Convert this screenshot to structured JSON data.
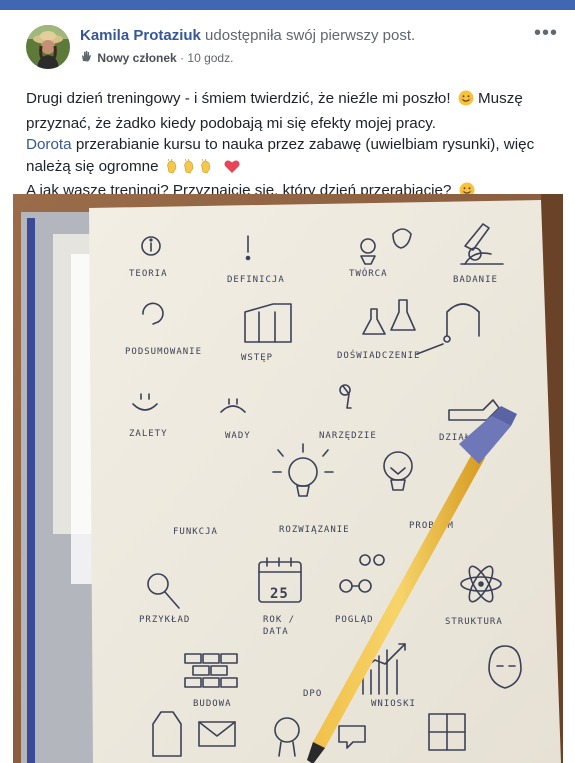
{
  "post": {
    "author_name": "Kamila Protaziuk",
    "action_text": "udostępniła swój pierwszy post.",
    "badge": "Nowy członek",
    "separator": "·",
    "time": "10 godz.",
    "more_label": "•••",
    "lines": {
      "line1": "Drugi dzień treningowy - i śmiem twierdzić, że nieźle mi poszło!",
      "line1b": "Muszę",
      "line2": "przyznać, że żadko kiedy podobają mi się efekty mojej pracy.",
      "mention": "Dorota",
      "line3_rest": "przerabianie kursu to nauka przez zabawę (uwielbiam rysunki), więc",
      "line4": "należą się ogromne",
      "line5": "A jak wasze treningi? Przyznajcie się, który dzień przerabiacie?"
    }
  },
  "sketch_labels": {
    "teoria": "TEORIA",
    "definicja": "DEFINICJA",
    "tworca": "TWÓRCA",
    "badanie": "BADANIE",
    "podsumowanie": "PODSUMOWANIE",
    "wstep": "WSTĘP",
    "doswiadczenie": "DOŚWIADCZENIE",
    "zalety": "ZALETY",
    "wady": "WADY",
    "narzedzie": "NARZĘDZIE",
    "dzialanie": "DZIAŁANIE",
    "funkcja": "FUNKCJA",
    "rozwiazanie": "ROZWIĄZANIE",
    "problem": "PROBLEM",
    "przyklad": "PRZYKŁAD",
    "calendar_num": "25",
    "rok": "ROK /",
    "data": "DATA",
    "poglad": "POGLĄD",
    "struktura": "STRUKTURA",
    "budowa": "BUDOWA",
    "wnioski": "WNIOSKI",
    "dpo": "DPO"
  },
  "colors": {
    "brand": "#4267b2",
    "link": "#365899",
    "text": "#1d2129",
    "meta": "#616770",
    "paper": "#efebe0",
    "ink": "#3c4158"
  }
}
